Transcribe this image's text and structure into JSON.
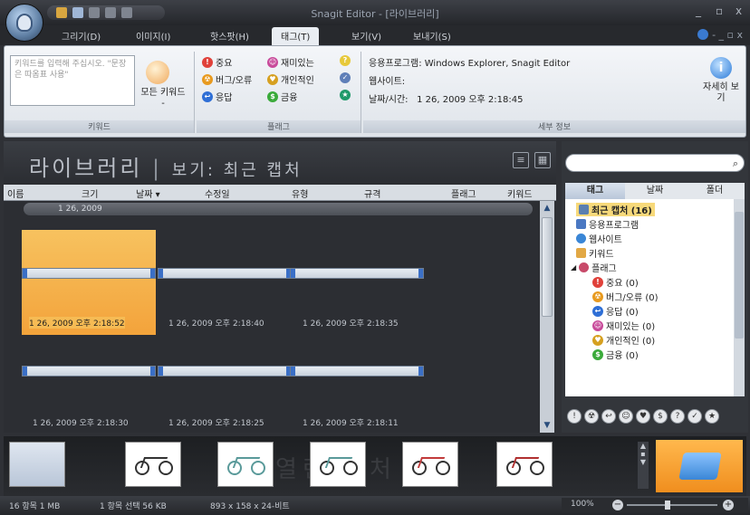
{
  "titlebar": {
    "title": "Snagit Editor - [라이브러리]",
    "minimize": "_",
    "maximize": "▫",
    "close": "x"
  },
  "tabs": [
    {
      "label": "그리기(D)"
    },
    {
      "label": "이미지(I)"
    },
    {
      "label": "핫스팟(H)"
    },
    {
      "label": "태그(T)"
    },
    {
      "label": "보기(V)"
    },
    {
      "label": "보내기(S)"
    }
  ],
  "tabs_right": "- _ ▫ x",
  "ribbon": {
    "keyword": {
      "placeholder": "키워드를 입력해 주십시오. \"문장은 따옴표 사용\"",
      "all_keywords": "모든 키워드 -",
      "group_label": "키워드"
    },
    "flags": {
      "items": [
        {
          "label": "중요",
          "icon": "!",
          "color": "#e0413a"
        },
        {
          "label": "재미있는",
          "icon": "☺",
          "color": "#c84a9a"
        },
        {
          "label": "",
          "icon": "?",
          "color": "#e7c93a"
        },
        {
          "label": "버그/오류",
          "icon": "☢",
          "color": "#e89a1f"
        },
        {
          "label": "개인적인",
          "icon": "♥",
          "color": "#d6a020"
        },
        {
          "label": "",
          "icon": "✓",
          "color": "#5f7fb8"
        },
        {
          "label": "응답",
          "icon": "↩",
          "color": "#2f6fd6"
        },
        {
          "label": "금융",
          "icon": "$",
          "color": "#3aaa3a"
        },
        {
          "label": "",
          "icon": "★",
          "color": "#1f9a6a"
        }
      ],
      "group_label": "플래그"
    },
    "info": {
      "app_label": "응용프로그램:",
      "app_value": "Windows Explorer, Snagit Editor",
      "website_label": "웹사이트:",
      "website_value": "",
      "datetime_label": "날짜/시간:",
      "datetime_value": "1 26, 2009 오후 2:18:45",
      "group_label": "세부 정보",
      "details_button": "자세히 보기"
    }
  },
  "library": {
    "title": "라이브러리",
    "view_label": "보기: 최근 캡처",
    "columns": [
      "이름",
      "크기",
      "날짜 ▾",
      "수정일",
      "유형",
      "규격",
      "플래그",
      "키워드"
    ],
    "date_group": "1 26, 2009",
    "captions": [
      "1 26, 2009 오후 2:18:52",
      "1 26, 2009 오후 2:18:40",
      "1 26, 2009 오후 2:18:35",
      "1 26, 2009 오후 2:18:30",
      "1 26, 2009 오후 2:18:25",
      "1 26, 2009 오후 2:18:11"
    ]
  },
  "right_panel": {
    "search_placeholder": "",
    "tabs": [
      "태그",
      "날짜",
      "폴더"
    ],
    "tree": [
      {
        "label": "최근 캡처 (16)",
        "highlight": true
      },
      {
        "label": "응용프로그램"
      },
      {
        "label": "웹사이트"
      },
      {
        "label": "키워드"
      },
      {
        "label": "플래그"
      },
      {
        "label": "중요 (0)"
      },
      {
        "label": "버그/오류 (0)"
      },
      {
        "label": "응답 (0)"
      },
      {
        "label": "재미있는 (0)"
      },
      {
        "label": "개인적인 (0)"
      },
      {
        "label": "금융 (0)"
      }
    ],
    "flag_row": [
      "!",
      "☢",
      "↩",
      "☺",
      "♥",
      "$",
      "?",
      "✓",
      "★"
    ]
  },
  "tray": {
    "watermark": "열린 캡처"
  },
  "status": {
    "items": "16 항목 1 MB",
    "selected": "1 항목 선택 56 KB",
    "dimensions": "893 x 158 x 24-비트",
    "zoom": "100%"
  }
}
